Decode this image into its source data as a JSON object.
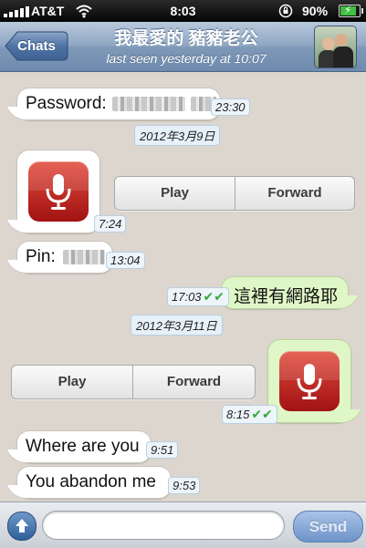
{
  "status_bar": {
    "carrier": "AT&T",
    "time": "8:03",
    "battery": "90%"
  },
  "nav": {
    "back_label": "Chats",
    "title": "我最愛的 豬豬老公",
    "subtitle": "last seen yesterday at 10:07"
  },
  "messages": {
    "m1": {
      "text": "Password:",
      "time": "23:30"
    },
    "date1": "2012年3月9日",
    "voice1": {
      "play": "Play",
      "forward": "Forward",
      "time": "7:24"
    },
    "m2": {
      "text": "Pin:",
      "time": "13:04"
    },
    "m3": {
      "text": "這裡有網路耶",
      "time": "17:03"
    },
    "date2": "2012年3月11日",
    "voice2": {
      "play": "Play",
      "forward": "Forward",
      "time": "8:15"
    },
    "m4": {
      "text": "Where are you",
      "time": "9:51"
    },
    "m5": {
      "text": "You abandon me",
      "time": "9:53"
    },
    "top_partial_text": "last seen yesterday at 10:07"
  },
  "composer": {
    "value": "",
    "placeholder": "",
    "send_label": "Send"
  },
  "icons": {
    "attach": "arrow-up-icon",
    "mic": "microphone-icon",
    "read": "double-check-icon",
    "wifi": "wifi-icon",
    "lock": "rotation-lock-icon"
  },
  "colors": {
    "nav": "#7f99b8",
    "chat_bg": "#dcd6cf",
    "outgoing": "#dff6c6",
    "incoming": "#ffffff",
    "send": "#6e93c9"
  }
}
